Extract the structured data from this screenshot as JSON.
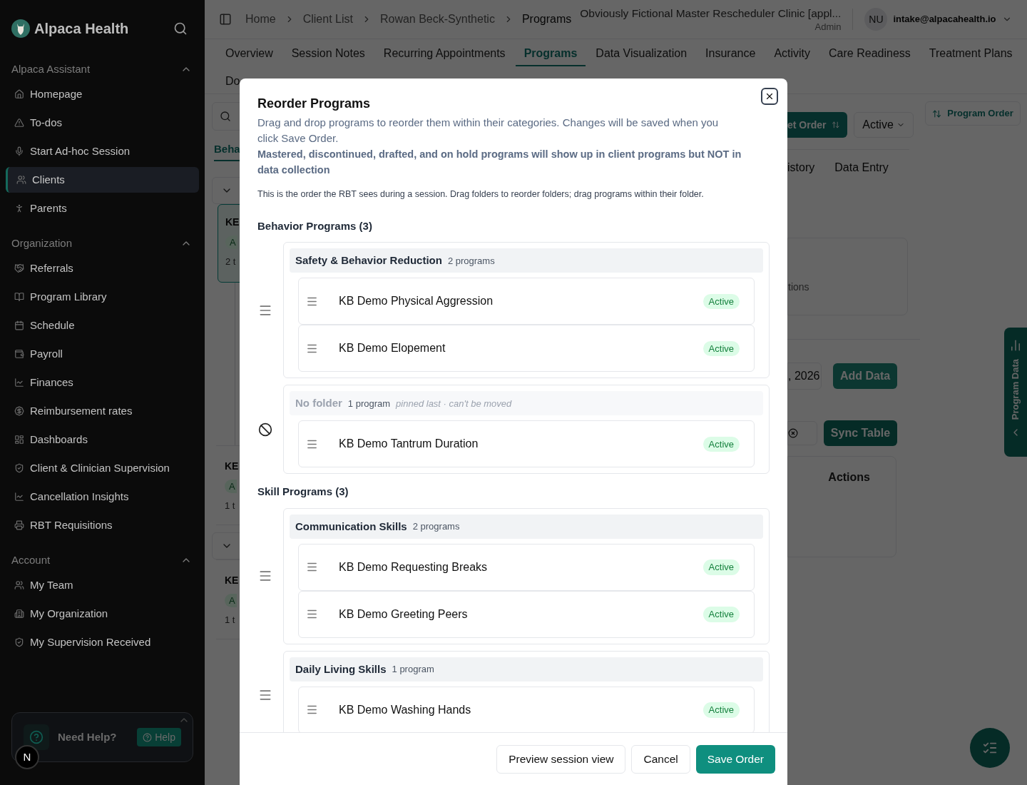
{
  "sidebar": {
    "brand": "Alpaca Health",
    "sections": [
      {
        "title": "Alpaca Assistant",
        "expanded": true,
        "items": [
          {
            "label": "Homepage",
            "selected": false
          },
          {
            "label": "To-dos",
            "selected": false
          },
          {
            "label": "Start Ad-hoc Session",
            "selected": false
          },
          {
            "label": "Clients",
            "selected": true
          },
          {
            "label": "Parents",
            "selected": false
          }
        ]
      },
      {
        "title": "Organization",
        "expanded": true,
        "items": [
          {
            "label": "Referrals",
            "selected": false
          },
          {
            "label": "Program Library",
            "selected": false
          },
          {
            "label": "Schedule",
            "selected": false
          },
          {
            "label": "Payroll",
            "selected": false
          },
          {
            "label": "Finances",
            "selected": false
          },
          {
            "label": "Reimbursement rates",
            "selected": false
          },
          {
            "label": "Dashboards",
            "selected": false
          },
          {
            "label": "Client & Clinician Supervision",
            "selected": false
          },
          {
            "label": "Cancellation Insights",
            "selected": false
          },
          {
            "label": "RBT Requisitions",
            "selected": false
          }
        ]
      },
      {
        "title": "Account",
        "expanded": true,
        "items": [
          {
            "label": "My Team",
            "selected": false
          },
          {
            "label": "My Organization",
            "selected": false
          },
          {
            "label": "My Supervision Received",
            "selected": false
          }
        ]
      }
    ],
    "help": {
      "title": "Need Help?",
      "button": "Help"
    },
    "avatar": "N"
  },
  "header": {
    "breadcrumbs": [
      "Home",
      "Client List",
      "Rowan Beck-Synthetic"
    ],
    "current": "Programs",
    "clinic": "Obviously Fictional Master Rescheduler Clinic [appl...",
    "role": "Admin",
    "user": {
      "initials": "NU",
      "email": "intake@alpacahealth.io"
    }
  },
  "tabs": [
    {
      "label": "Overview",
      "selected": false
    },
    {
      "label": "Session Notes",
      "selected": false
    },
    {
      "label": "Recurring Appointments",
      "selected": false
    },
    {
      "label": "Programs",
      "selected": true
    },
    {
      "label": "Data Visualization",
      "selected": false
    },
    {
      "label": "Insurance",
      "selected": false
    },
    {
      "label": "Activity",
      "selected": false
    },
    {
      "label": "Care Readiness",
      "selected": false
    },
    {
      "label": "Treatment Plans",
      "selected": false
    }
  ],
  "tabs_row2": "Do",
  "background": {
    "left": {
      "subtab": "Beha",
      "groups": [
        {
          "cards": [
            {
              "title": "KE",
              "badge": "A",
              "meta": "2 t",
              "highlighted": true
            },
            {
              "title": "KE",
              "badge": "A",
              "meta": "1 t",
              "highlighted": false
            }
          ]
        },
        {
          "cards": [
            {
              "title": "KE",
              "badge": "A",
              "meta": "1 t",
              "highlighted": false
            }
          ]
        }
      ]
    },
    "right": {
      "order_button": "et Order",
      "status_select": "Active",
      "program_order": "Program Order",
      "subtabs": [
        "istory",
        "Data Entry"
      ],
      "card_text": "tions",
      "date": ", 2026",
      "add_data": "Add Data",
      "sync_table": "Sync Table",
      "table_header": "Actions",
      "side_tab": "Program Data"
    }
  },
  "modal": {
    "title": "Reorder Programs",
    "description": "Drag and drop programs to reorder them within their categories. Changes will be saved when you click Save Order.",
    "note": "Mastered, discontinued, drafted, and on hold programs will show up in client programs but NOT in data collection",
    "hint": "This is the order the RBT sees during a session. Drag folders to reorder folders; drag programs within their folder.",
    "sections": [
      {
        "title": "Behavior Programs (3)",
        "folders": [
          {
            "name": "Safety & Behavior Reduction",
            "count": "2 programs",
            "pinned": false,
            "programs": [
              {
                "name": "KB Demo Physical Aggression",
                "status": "Active"
              },
              {
                "name": "KB Demo Elopement",
                "status": "Active"
              }
            ]
          },
          {
            "name": "No folder",
            "count": "1 program",
            "pinned": true,
            "note": "pinned last · can't be moved",
            "programs": [
              {
                "name": "KB Demo Tantrum Duration",
                "status": "Active"
              }
            ]
          }
        ]
      },
      {
        "title": "Skill Programs (3)",
        "folders": [
          {
            "name": "Communication Skills",
            "count": "2 programs",
            "pinned": false,
            "programs": [
              {
                "name": "KB Demo Requesting Breaks",
                "status": "Active"
              },
              {
                "name": "KB Demo Greeting Peers",
                "status": "Active"
              }
            ]
          },
          {
            "name": "Daily Living Skills",
            "count": "1 program",
            "pinned": false,
            "programs": [
              {
                "name": "KB Demo Washing Hands",
                "status": "Active"
              }
            ]
          }
        ]
      }
    ],
    "buttons": [
      {
        "label": "Preview session view",
        "kind": "secondary"
      },
      {
        "label": "Cancel",
        "kind": "secondary"
      },
      {
        "label": "Save Order",
        "kind": "primary"
      }
    ]
  }
}
